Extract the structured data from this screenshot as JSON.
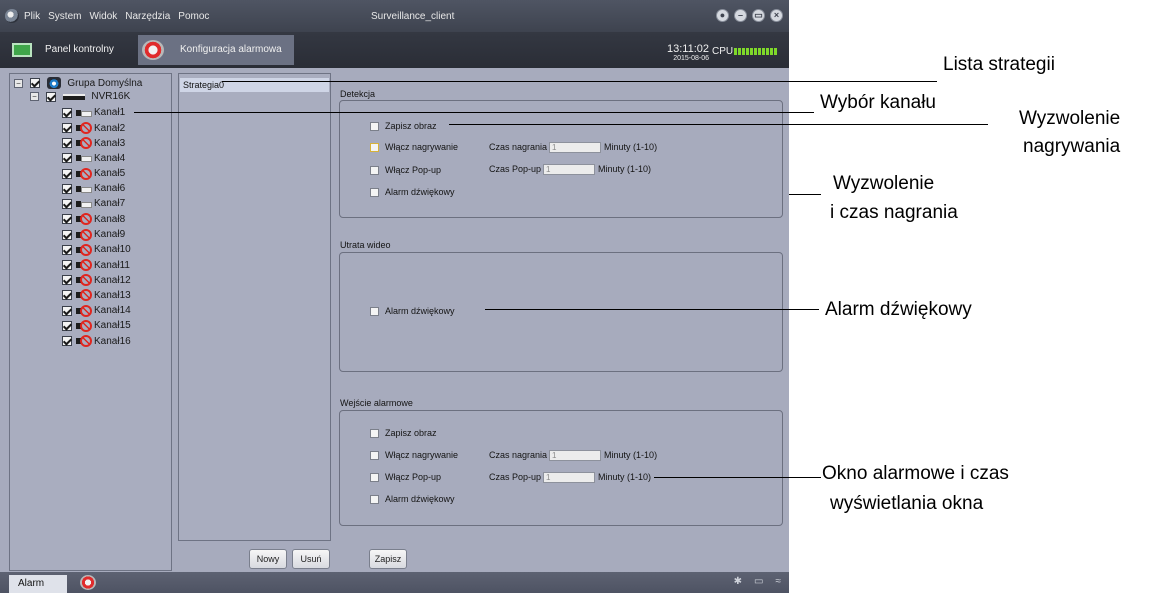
{
  "window": {
    "title": "Surveillance_client",
    "menu": [
      "Plik",
      "System",
      "Widok",
      "Narzędzia",
      "Pomoc"
    ],
    "controls": [
      "●",
      "–",
      "▭",
      "×"
    ]
  },
  "tabs": [
    {
      "label": "Panel kontrolny",
      "active": false
    },
    {
      "label": "Konfiguracja alarmowa",
      "active": true,
      "close": "✖"
    }
  ],
  "status": {
    "time": "13:11:02",
    "date": "2015-08-06",
    "cpu_label": "CPU"
  },
  "tree": {
    "group": "Grupa Domyślna",
    "device": "NVR16K",
    "expand_symbol": "−",
    "channels": [
      {
        "label": "Kanał1",
        "online": true
      },
      {
        "label": "Kanał2",
        "online": false
      },
      {
        "label": "Kanał3",
        "online": false
      },
      {
        "label": "Kanał4",
        "online": true
      },
      {
        "label": "Kanał5",
        "online": false
      },
      {
        "label": "Kanał6",
        "online": true
      },
      {
        "label": "Kanał7",
        "online": true
      },
      {
        "label": "Kanał8",
        "online": false
      },
      {
        "label": "Kanał9",
        "online": false
      },
      {
        "label": "Kanał10",
        "online": false
      },
      {
        "label": "Kanał11",
        "online": false
      },
      {
        "label": "Kanał12",
        "online": false
      },
      {
        "label": "Kanał13",
        "online": false
      },
      {
        "label": "Kanał14",
        "online": false
      },
      {
        "label": "Kanał15",
        "online": false
      },
      {
        "label": "Kanał16",
        "online": false
      }
    ]
  },
  "strategies": {
    "items": [
      "Strategia0"
    ],
    "new_button": "Nowy",
    "delete_button": "Usuń"
  },
  "detection": {
    "title": "Detekcja",
    "save_image": "Zapisz obraz",
    "enable_recording": "Włącz nagrywanie",
    "record_time_label": "Czas nagrania",
    "record_time_value": "1",
    "record_range": "Minuty (1-10)",
    "enable_popup": "Włącz Pop-up",
    "popup_time_label": "Czas Pop-up",
    "popup_time_value": "1",
    "popup_range": "Minuty (1-10)",
    "sound_alarm": "Alarm dźwiękowy"
  },
  "video_loss": {
    "title": "Utrata wideo",
    "sound_alarm": "Alarm dźwiękowy"
  },
  "alarm_input": {
    "title": "Wejście alarmowe",
    "save_image": "Zapisz obraz",
    "enable_recording": "Włącz nagrywanie",
    "record_time_label": "Czas nagrania",
    "record_time_value": "1",
    "record_range": "Minuty (1-10)",
    "enable_popup": "Włącz Pop-up",
    "popup_time_label": "Czas Pop-up",
    "popup_time_value": "1",
    "popup_range": "Minuty (1-10)",
    "sound_alarm": "Alarm dźwiękowy"
  },
  "save_button": "Zapisz",
  "bottom": {
    "alarm_tab": "Alarm",
    "icons": [
      "✱",
      "▭",
      "≈"
    ]
  },
  "callouts": {
    "strategy_list": "Lista strategii",
    "channel_select": "Wybór kanału",
    "record_trigger_1": "Wyzwolenie",
    "record_trigger_2": "nagrywania",
    "trigger_time_1": "Wyzwolenie",
    "trigger_time_2": "i czas nagrania",
    "sound_alarm": "Alarm dźwiękowy",
    "alarm_window_1": "Okno alarmowe i czas",
    "alarm_window_2": "wyświetlania okna"
  }
}
